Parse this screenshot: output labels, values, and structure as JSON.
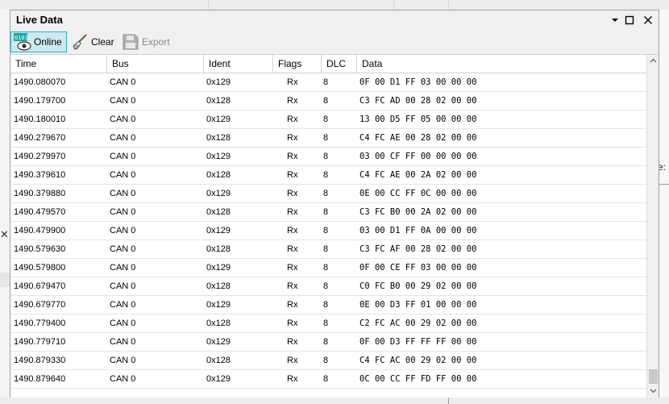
{
  "window": {
    "title": "Live Data"
  },
  "toolbar": {
    "online_label": "Online",
    "clear_label": "Clear",
    "export_label": "Export",
    "online_icon_text": "0101"
  },
  "columns": [
    "Time",
    "Bus",
    "Ident",
    "Flags",
    "DLC",
    "Data"
  ],
  "rows": [
    {
      "time": "1490.080070",
      "bus": "CAN 0",
      "ident": "0x129",
      "flags": "Rx",
      "dlc": "8",
      "data": "0F 00 D1 FF 03 00 00 00"
    },
    {
      "time": "1490.179700",
      "bus": "CAN 0",
      "ident": "0x128",
      "flags": "Rx",
      "dlc": "8",
      "data": "C3 FC AD 00 28 02 00 00"
    },
    {
      "time": "1490.180010",
      "bus": "CAN 0",
      "ident": "0x129",
      "flags": "Rx",
      "dlc": "8",
      "data": "13 00 D5 FF 05 00 00 00"
    },
    {
      "time": "1490.279670",
      "bus": "CAN 0",
      "ident": "0x128",
      "flags": "Rx",
      "dlc": "8",
      "data": "C4 FC AE 00 28 02 00 00"
    },
    {
      "time": "1490.279970",
      "bus": "CAN 0",
      "ident": "0x129",
      "flags": "Rx",
      "dlc": "8",
      "data": "03 00 CF FF 00 00 00 00"
    },
    {
      "time": "1490.379610",
      "bus": "CAN 0",
      "ident": "0x128",
      "flags": "Rx",
      "dlc": "8",
      "data": "C4 FC AE 00 2A 02 00 00"
    },
    {
      "time": "1490.379880",
      "bus": "CAN 0",
      "ident": "0x129",
      "flags": "Rx",
      "dlc": "8",
      "data": "0E 00 CC FF 0C 00 00 00"
    },
    {
      "time": "1490.479570",
      "bus": "CAN 0",
      "ident": "0x128",
      "flags": "Rx",
      "dlc": "8",
      "data": "C3 FC B0 00 2A 02 00 00"
    },
    {
      "time": "1490.479900",
      "bus": "CAN 0",
      "ident": "0x129",
      "flags": "Rx",
      "dlc": "8",
      "data": "03 00 D1 FF 0A 00 00 00"
    },
    {
      "time": "1490.579630",
      "bus": "CAN 0",
      "ident": "0x128",
      "flags": "Rx",
      "dlc": "8",
      "data": "C3 FC AF 00 28 02 00 00"
    },
    {
      "time": "1490.579800",
      "bus": "CAN 0",
      "ident": "0x129",
      "flags": "Rx",
      "dlc": "8",
      "data": "0F 00 CE FF 03 00 00 00"
    },
    {
      "time": "1490.679470",
      "bus": "CAN 0",
      "ident": "0x128",
      "flags": "Rx",
      "dlc": "8",
      "data": "C0 FC B0 00 29 02 00 00"
    },
    {
      "time": "1490.679770",
      "bus": "CAN 0",
      "ident": "0x129",
      "flags": "Rx",
      "dlc": "8",
      "data": "0E 00 D3 FF 01 00 00 00"
    },
    {
      "time": "1490.779400",
      "bus": "CAN 0",
      "ident": "0x128",
      "flags": "Rx",
      "dlc": "8",
      "data": "C2 FC AC 00 29 02 00 00"
    },
    {
      "time": "1490.779710",
      "bus": "CAN 0",
      "ident": "0x129",
      "flags": "Rx",
      "dlc": "8",
      "data": "0F 00 D3 FF FF FF 00 00"
    },
    {
      "time": "1490.879330",
      "bus": "CAN 0",
      "ident": "0x128",
      "flags": "Rx",
      "dlc": "8",
      "data": "C4 FC AC 00 29 02 00 00"
    },
    {
      "time": "1490.879640",
      "bus": "CAN 0",
      "ident": "0x129",
      "flags": "Rx",
      "dlc": "8",
      "data": "0C 00 CC FF FD FF 00 00"
    }
  ],
  "background": {
    "right_fragment": "e:"
  },
  "colors": {
    "online_active_bg": "#cce8f0",
    "online_active_border": "#2fb0c8",
    "accent_icon": "#1aa5a5"
  },
  "icons": [
    "online-icon",
    "broom-icon",
    "floppy-disk-icon",
    "dropdown-arrow-icon",
    "maximize-icon",
    "close-icon"
  ]
}
